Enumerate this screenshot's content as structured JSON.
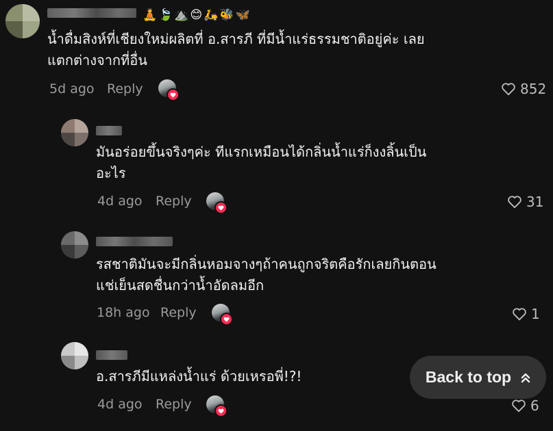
{
  "comments": [
    {
      "emoji_row": "🧘🍃⛰️😊🛵🐝🦋",
      "text": "น้ำดื่มสิงห์ที่เชียงใหม่ผลิตที่ อ.สารภี ที่มีน้ำแร่ธรรมชาติอยู่ค่ะ เลย\nแตกต่างจากที่อื่น",
      "time": "5d ago",
      "reply_label": "Reply",
      "likes": "852"
    },
    {
      "text": "มันอร่อยขึ้นจริงๆค่ะ ทีแรกเหมือนได้กลิ่นน้ำแร่ก็งงลิ้นเป็น\nอะไร",
      "time": "4d ago",
      "reply_label": "Reply",
      "likes": "31"
    },
    {
      "text": "รสชาติมันจะมีกลิ่นหอมจางๆถ้าคนถูกจริตคือรักเลยกินตอน\nแช่เย็นสดชื่นกว่าน้ำอัดลมอีก",
      "time": "18h ago",
      "reply_label": "Reply",
      "likes": "1"
    },
    {
      "text": "อ.สารภีมีแหล่งน้ำแร่ ด้วยเหรอพี่!?!",
      "time": "4d ago",
      "reply_label": "Reply",
      "likes": "6"
    }
  ],
  "back_to_top": {
    "label": "Back to top",
    "icon": "double-chevron-up-icon"
  },
  "colors": {
    "background": "#121212",
    "secondary_text": "#9b9b9b",
    "badge": "#fe2c55",
    "button_bg": "#323232"
  }
}
